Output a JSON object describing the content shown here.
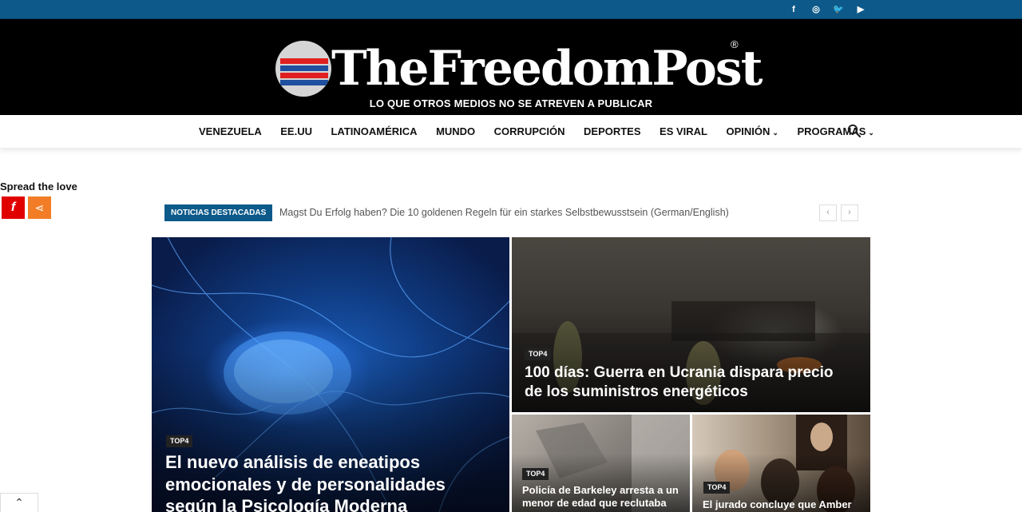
{
  "topbar": {
    "social": [
      {
        "icon": "facebook-icon",
        "glyph": "f"
      },
      {
        "icon": "instagram-icon",
        "glyph": "◎"
      },
      {
        "icon": "twitter-icon",
        "glyph": "🐦"
      },
      {
        "icon": "youtube-icon",
        "glyph": "▶"
      }
    ]
  },
  "header": {
    "logo_text": "TheFreedomPost",
    "registered": "®",
    "tagline": "LO QUE OTROS MEDIOS NO SE ATREVEN A PUBLICAR"
  },
  "nav": {
    "items": [
      {
        "label": "VENEZUELA"
      },
      {
        "label": "EE.UU"
      },
      {
        "label": "LATINOAMÉRICA"
      },
      {
        "label": "MUNDO"
      },
      {
        "label": "CORRUPCIÓN"
      },
      {
        "label": "DEPORTES"
      },
      {
        "label": "ES VIRAL"
      },
      {
        "label": "OPINIÓN"
      },
      {
        "label": "PROGRAMAS"
      }
    ]
  },
  "spread": {
    "title": "Spread the love"
  },
  "ticker": {
    "label": "NOTICIAS DESTACADAS",
    "text": "Magst Du Erfolg haben? Die 10 goldenen Regeln für ein starkes Selbstbewusstsein (German/English)",
    "prev": "‹",
    "next": "›"
  },
  "tiles": {
    "main": {
      "badge": "TOP4",
      "title": "El nuevo análisis de eneatipos emocionales y de personalidades según la Psicología Moderna"
    },
    "war": {
      "badge": "TOP4",
      "title": "100 días: Guerra en Ucrania dispara precio de los suministros energéticos"
    },
    "police": {
      "badge": "TOP4",
      "title": "Policía de Barkeley arresta a un menor de edad que reclutaba"
    },
    "jury": {
      "badge": "TOP4",
      "title": "El jurado concluye que Amber"
    }
  },
  "colors": {
    "topbar": "#0d5a8a",
    "header_bg": "#000000",
    "ticker_label": "#0d5a8a",
    "share_red": "#e10000",
    "share_orange": "#f27d26"
  }
}
